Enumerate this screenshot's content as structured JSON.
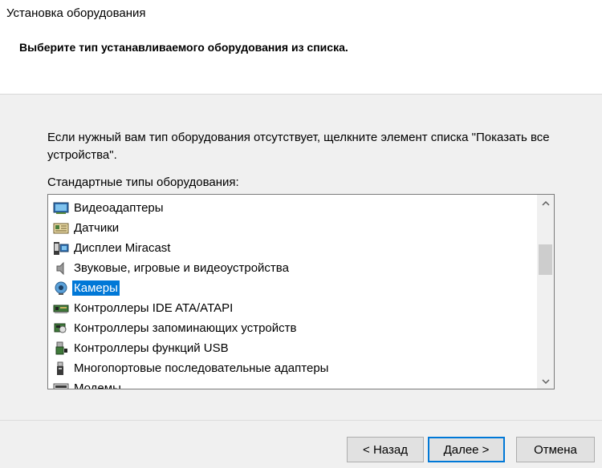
{
  "window": {
    "title": "Установка оборудования",
    "heading": "Выберите тип устанавливаемого оборудования из списка."
  },
  "main": {
    "instruction": "Если нужный вам тип оборудования отсутствует, щелкните элемент списка \"Показать все устройства\".",
    "list_label": "Стандартные типы оборудования:",
    "items": [
      {
        "label": "Видеоадаптеры",
        "icon": "display-adapter-icon",
        "selected": false
      },
      {
        "label": "Датчики",
        "icon": "sensor-icon",
        "selected": false
      },
      {
        "label": "Дисплеи Miracast",
        "icon": "miracast-display-icon",
        "selected": false
      },
      {
        "label": "Звуковые, игровые и видеоустройства",
        "icon": "speaker-icon",
        "selected": false
      },
      {
        "label": "Камеры",
        "icon": "webcam-icon",
        "selected": true
      },
      {
        "label": "Контроллеры IDE ATA/ATAPI",
        "icon": "ide-controller-icon",
        "selected": false
      },
      {
        "label": "Контроллеры запоминающих устройств",
        "icon": "storage-controller-icon",
        "selected": false
      },
      {
        "label": "Контроллеры функций USB",
        "icon": "usb-icon",
        "selected": false
      },
      {
        "label": "Многопортовые последовательные адаптеры",
        "icon": "serial-port-icon",
        "selected": false
      },
      {
        "label": "Модемы",
        "icon": "modem-icon",
        "selected": false
      }
    ]
  },
  "buttons": {
    "back": "< Назад",
    "next": "Далее >",
    "cancel": "Отмена"
  },
  "colors": {
    "selection": "#0078d7",
    "dialog_background": "#f0f0f0",
    "header_background": "#ffffff"
  }
}
